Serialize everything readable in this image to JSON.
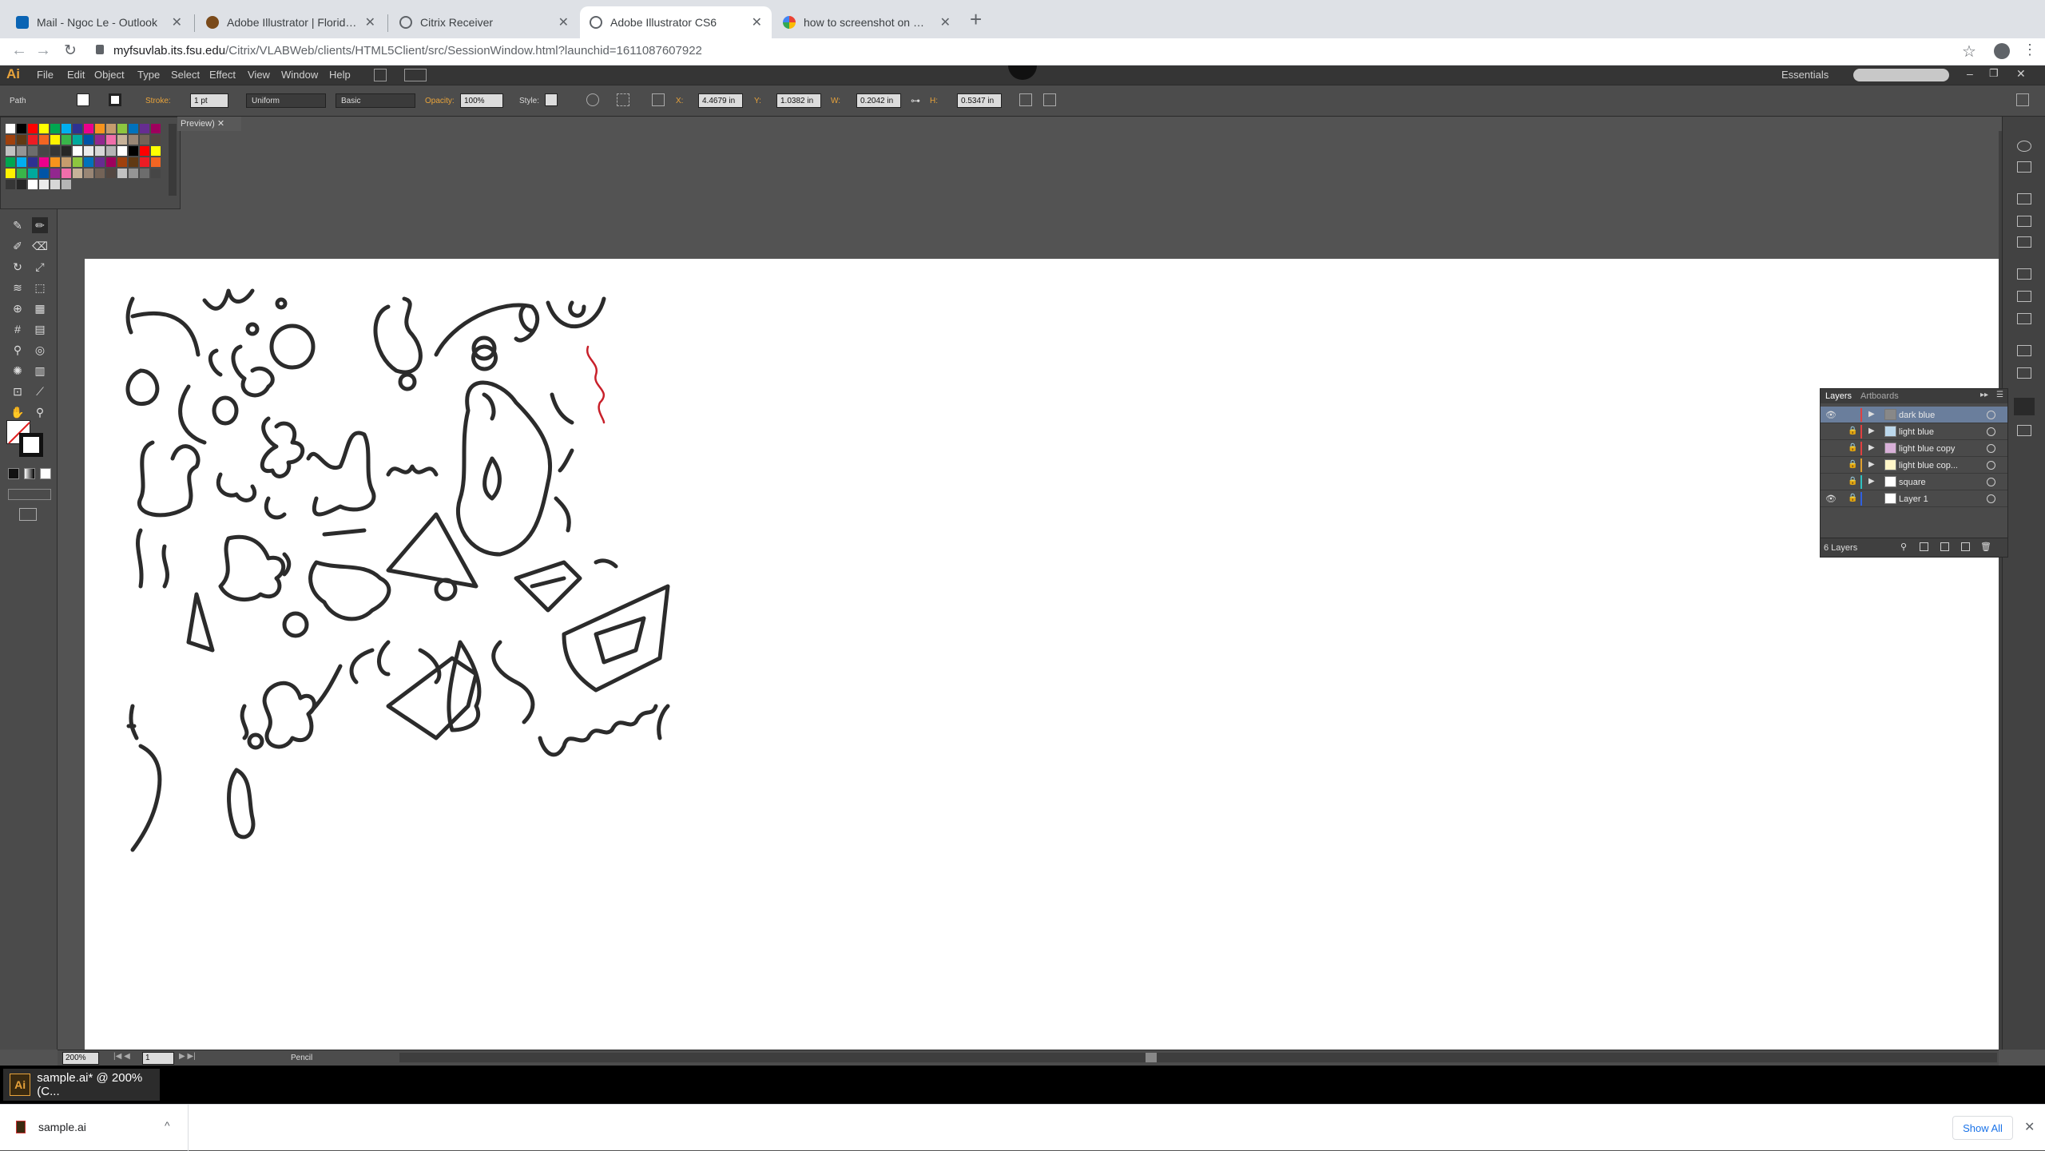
{
  "browser": {
    "tabs": [
      {
        "label": "Mail - Ngoc Le - Outlook",
        "color": "#0a64b4"
      },
      {
        "label": "Adobe Illustrator | Florida State",
        "color": "#7a4a1a"
      },
      {
        "label": "Citrix Receiver",
        "color": "#5f6368"
      },
      {
        "label": "Adobe Illustrator CS6",
        "color": "#5f6368"
      },
      {
        "label": "how to screenshot on mac - Go",
        "color": "#4285f4"
      }
    ],
    "url_host": "myfsuvlab.its.fsu.edu",
    "url_path": "/Citrix/VLABWeb/clients/HTML5Client/src/SessionWindow.html?launchid=1611087607922"
  },
  "app": {
    "logo": "Ai",
    "menus": [
      "File",
      "Edit",
      "Object",
      "Type",
      "Select",
      "Effect",
      "View",
      "Window",
      "Help"
    ],
    "workspace": "Essentials",
    "control": {
      "selection": "Path",
      "stroke_label": "Stroke:",
      "stroke_value": "1 pt",
      "profile": "Uniform",
      "brush": "Basic",
      "opacity_label": "Opacity:",
      "opacity_value": "100%",
      "style_label": "Style:",
      "x_label": "X:",
      "x_value": "4.4679 in",
      "y_label": "Y:",
      "y_value": "1.0382 in",
      "w_label": "W:",
      "w_value": "0.2042 in",
      "h_label": "H:",
      "h_value": "0.5347 in"
    },
    "doc_tab": "Preview)",
    "status": {
      "zoom": "200%",
      "page": "1",
      "tool": "Pencil"
    },
    "layers": {
      "tab_layers": "Layers",
      "tab_artboards": "Artboards",
      "rows": [
        {
          "name": "dark blue",
          "color": "#e04040",
          "thumb": "#888888"
        },
        {
          "name": "light blue",
          "color": "#e04040",
          "thumb": "#bcd8ec"
        },
        {
          "name": "light blue copy",
          "color": "#e04040",
          "thumb": "#d8b0d8"
        },
        {
          "name": "light blue cop...",
          "color": "#e0a030",
          "thumb": "#fff6c8"
        },
        {
          "name": "square",
          "color": "#30c0c0",
          "thumb": "#ffffff"
        },
        {
          "name": "Layer 1",
          "color": "#3060e0",
          "thumb": "#ffffff"
        }
      ],
      "count": "6 Layers"
    }
  },
  "taskbar": {
    "item": "sample.ai* @ 200% (C..."
  },
  "downloads": {
    "file": "sample.ai",
    "show_all": "Show All"
  }
}
